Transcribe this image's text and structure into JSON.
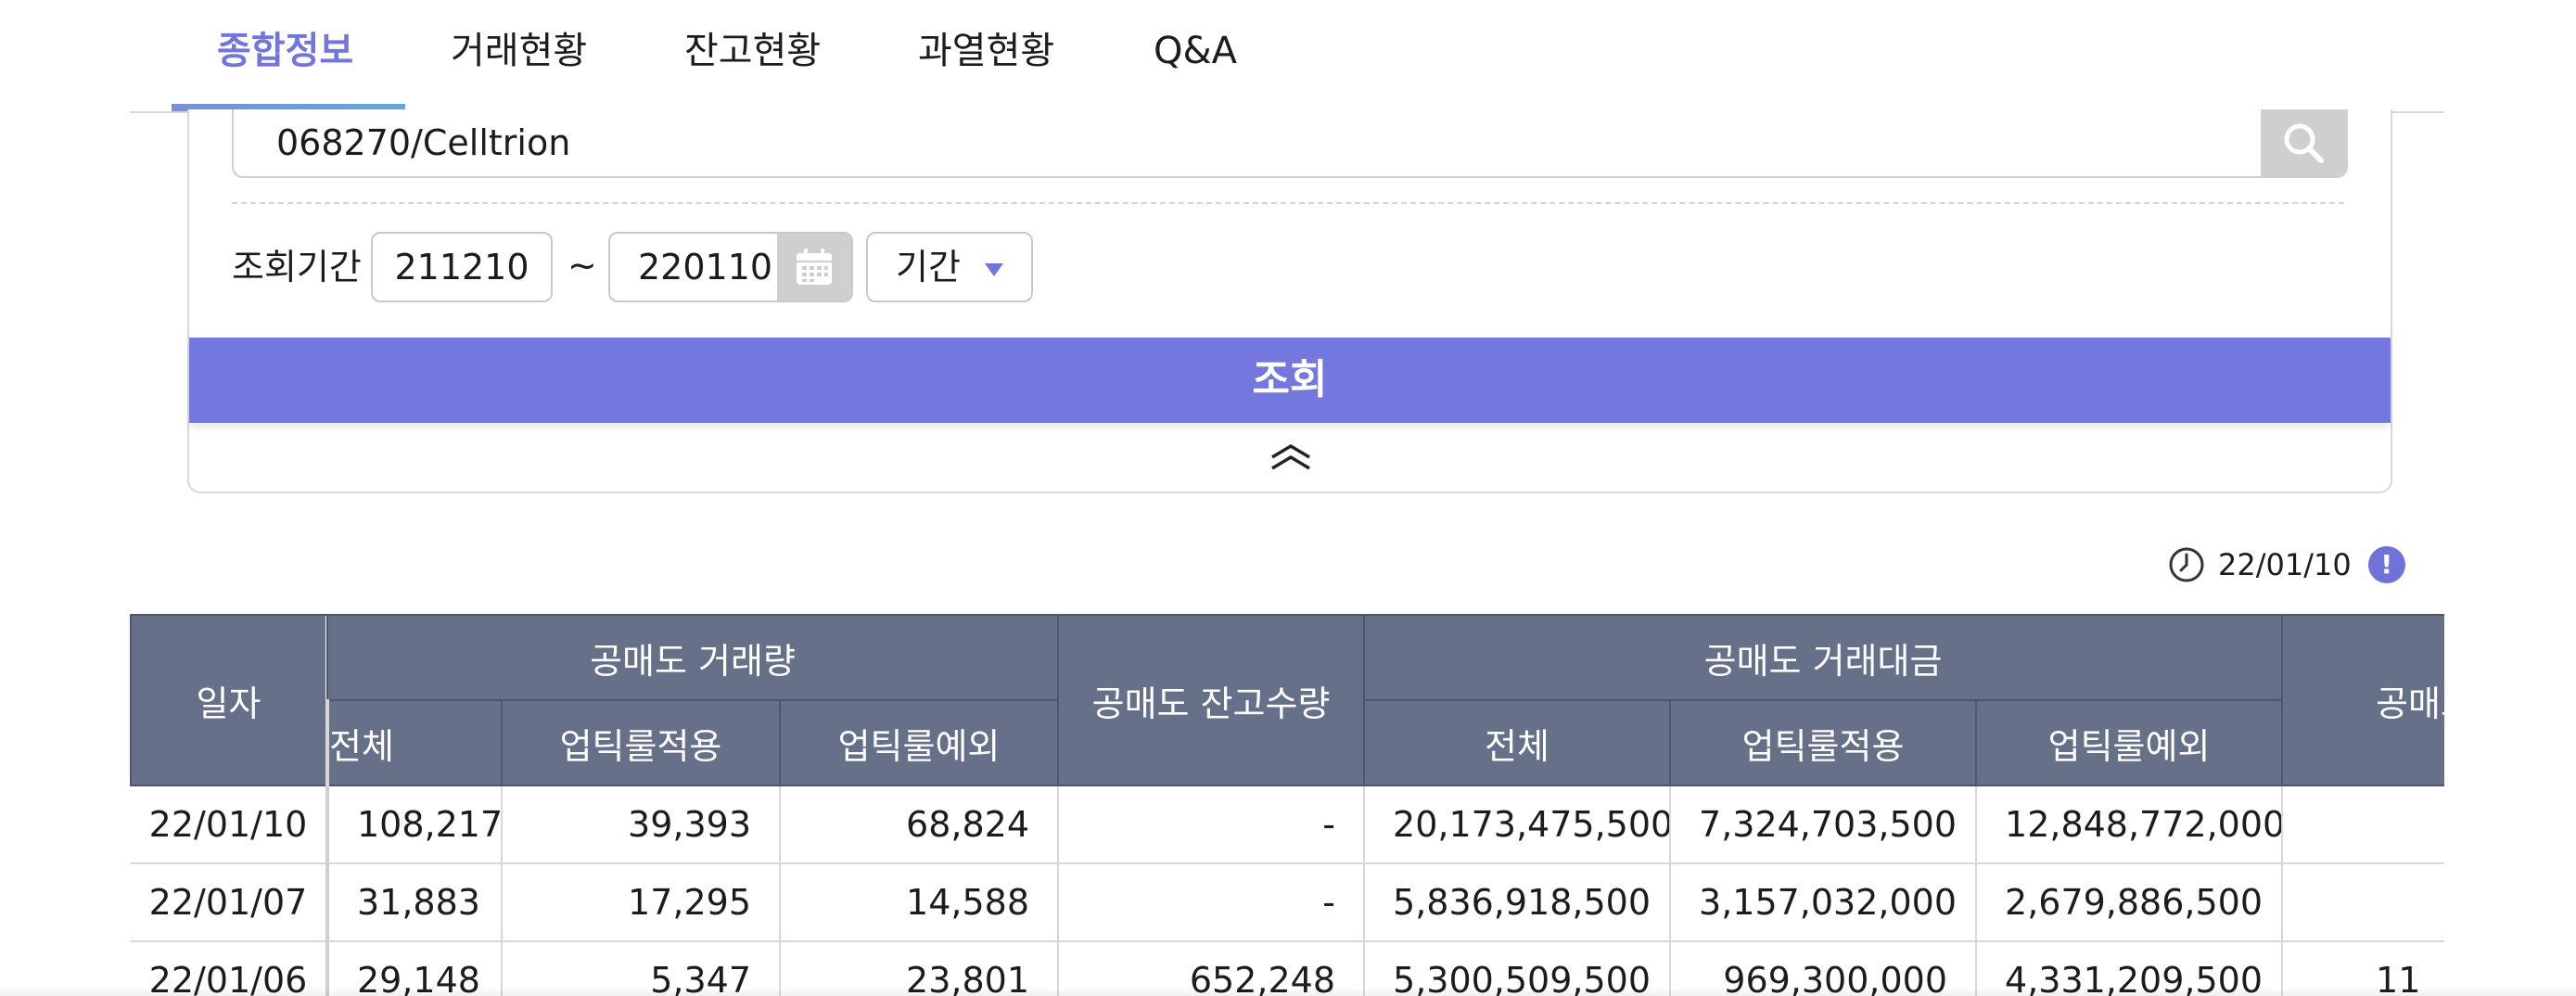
{
  "tabs": [
    {
      "label": "종합정보",
      "active": true
    },
    {
      "label": "거래현황",
      "active": false
    },
    {
      "label": "잔고현황",
      "active": false
    },
    {
      "label": "과열현황",
      "active": false
    },
    {
      "label": "Q&A",
      "active": false
    }
  ],
  "search": {
    "value": "068270/Celltrion",
    "icon": "search-icon"
  },
  "period": {
    "label": "조회기간",
    "start": "211210",
    "separator": "~",
    "end": "220110",
    "calendar_icon": "calendar-icon",
    "select_value": "기간"
  },
  "query_button": {
    "label": "조회"
  },
  "collapse_icon": "chevron-double-up-icon",
  "timestamp": {
    "value": "22/01/10",
    "clock_icon": "clock-icon",
    "info_icon": "!"
  },
  "table": {
    "groups": {
      "date": "일자",
      "volume": "공매도 거래량",
      "balance": "공매도 잔고수량",
      "amount": "공매도 거래대금",
      "clipped": "공매도"
    },
    "sub_headers": {
      "volume": [
        "전체",
        "업틱룰적용",
        "업틱룰예외"
      ],
      "amount": [
        "전체",
        "업틱룰적용",
        "업틱룰예외"
      ]
    },
    "rows": [
      {
        "date": "22/01/10",
        "vol_total": "108,217",
        "vol_uptick": "39,393",
        "vol_except": "68,824",
        "balance": "-",
        "amt_total": "20,173,475,500",
        "amt_uptick": "7,324,703,500",
        "amt_except": "12,848,772,000",
        "extra": ""
      },
      {
        "date": "22/01/07",
        "vol_total": "31,883",
        "vol_uptick": "17,295",
        "vol_except": "14,588",
        "balance": "-",
        "amt_total": "5,836,918,500",
        "amt_uptick": "3,157,032,000",
        "amt_except": "2,679,886,500",
        "extra": ""
      },
      {
        "date": "22/01/06",
        "vol_total": "29,148",
        "vol_uptick": "5,347",
        "vol_except": "23,801",
        "balance": "652,248",
        "amt_total": "5,300,509,500",
        "amt_uptick": "969,300,000",
        "amt_except": "4,331,209,500",
        "extra": "11"
      }
    ]
  }
}
